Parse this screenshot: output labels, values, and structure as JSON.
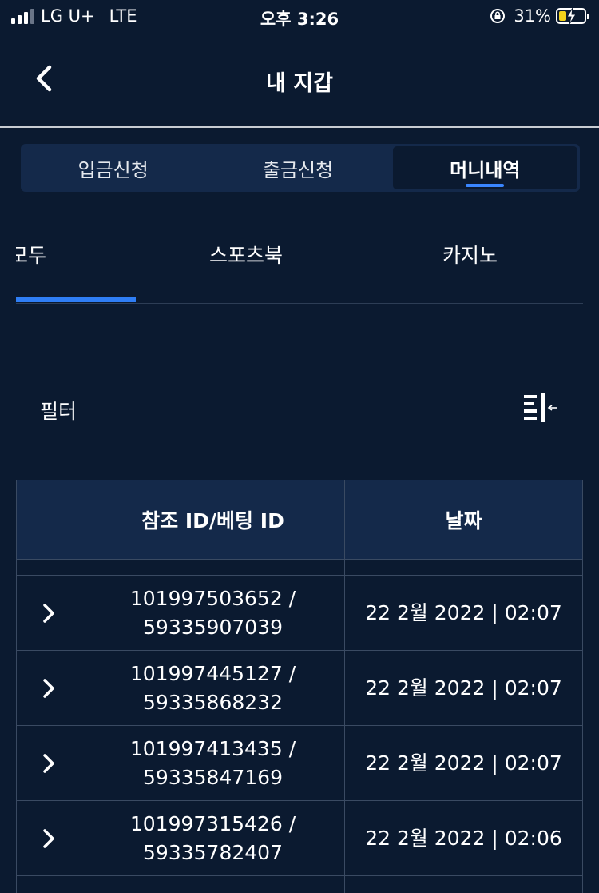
{
  "status_bar": {
    "carrier": "LG U+",
    "network": "LTE",
    "time": "오후 3:26",
    "battery_percent": "31%",
    "battery_level": 0.31
  },
  "header": {
    "title": "내 지갑"
  },
  "wallet_tabs": [
    {
      "label": "입금신청",
      "active": false
    },
    {
      "label": "출금신청",
      "active": false
    },
    {
      "label": "머니내역",
      "active": true
    }
  ],
  "sub_tabs": [
    {
      "label": "모두",
      "active": true
    },
    {
      "label": "스포츠북",
      "active": false
    },
    {
      "label": "카지노",
      "active": false
    }
  ],
  "filter": {
    "label": "필터"
  },
  "table": {
    "columns": [
      "",
      "참조 ID/베팅 ID",
      "날짜"
    ],
    "rows": [
      {
        "ref_id": "101997503652 /",
        "bet_id": "59335907039",
        "date": "22 2월 2022 | 02:07"
      },
      {
        "ref_id": "101997445127 /",
        "bet_id": "59335868232",
        "date": "22 2월 2022 | 02:07"
      },
      {
        "ref_id": "101997413435 /",
        "bet_id": "59335847169",
        "date": "22 2월 2022 | 02:07"
      },
      {
        "ref_id": "101997315426 /",
        "bet_id": "59335782407",
        "date": "22 2월 2022 | 02:06"
      }
    ]
  },
  "colors": {
    "background": "#0b1a30",
    "panel": "#14294a",
    "accent": "#2f7ef5",
    "battery": "#f2d21b"
  }
}
